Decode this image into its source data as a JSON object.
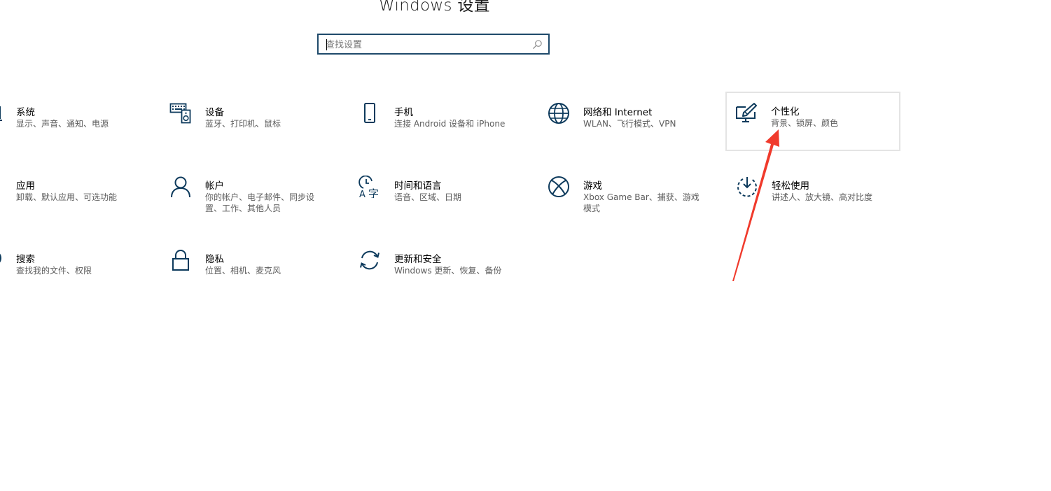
{
  "window": {
    "title": "Windows 设置"
  },
  "search": {
    "placeholder": "查找设置",
    "icon": "search-icon"
  },
  "colors": {
    "accent": "#1f4a6b",
    "icon": "#0d3a5c",
    "desc_text": "#5c5c5c",
    "focus_border": "#e4e4e4",
    "annotation_arrow": "#f03a2c"
  },
  "categories": [
    {
      "id": "system",
      "title": "系统",
      "desc": "显示、声音、通知、电源",
      "icon": "laptop-icon"
    },
    {
      "id": "devices",
      "title": "设备",
      "desc": "蓝牙、打印机、鼠标",
      "icon": "keyboard-speaker-icon"
    },
    {
      "id": "phone",
      "title": "手机",
      "desc": "连接 Android 设备和 iPhone",
      "icon": "phone-icon"
    },
    {
      "id": "network",
      "title": "网络和 Internet",
      "desc": "WLAN、飞行模式、VPN",
      "icon": "globe-icon"
    },
    {
      "id": "personalization",
      "title": "个性化",
      "desc": "背景、锁屏、颜色",
      "icon": "paintbrush-monitor-icon",
      "focused": true
    },
    {
      "id": "apps",
      "title": "应用",
      "desc": "卸载、默认应用、可选功能",
      "icon": "apps-list-icon"
    },
    {
      "id": "accounts",
      "title": "帐户",
      "desc": "你的帐户、电子邮件、同步设置、工作、其他人员",
      "icon": "person-icon"
    },
    {
      "id": "time-language",
      "title": "时间和语言",
      "desc": "语音、区域、日期",
      "icon": "clock-language-icon"
    },
    {
      "id": "gaming",
      "title": "游戏",
      "desc": "Xbox Game Bar、捕获、游戏模式",
      "icon": "xbox-icon"
    },
    {
      "id": "ease-of-access",
      "title": "轻松使用",
      "desc": "讲述人、放大镜、高对比度",
      "icon": "ease-of-access-icon"
    },
    {
      "id": "search",
      "title": "搜索",
      "desc": "查找我的文件、权限",
      "icon": "magnifier-icon"
    },
    {
      "id": "privacy",
      "title": "隐私",
      "desc": "位置、相机、麦克风",
      "icon": "lock-icon"
    },
    {
      "id": "update-security",
      "title": "更新和安全",
      "desc": "Windows 更新、恢复、备份",
      "icon": "refresh-icon"
    }
  ]
}
